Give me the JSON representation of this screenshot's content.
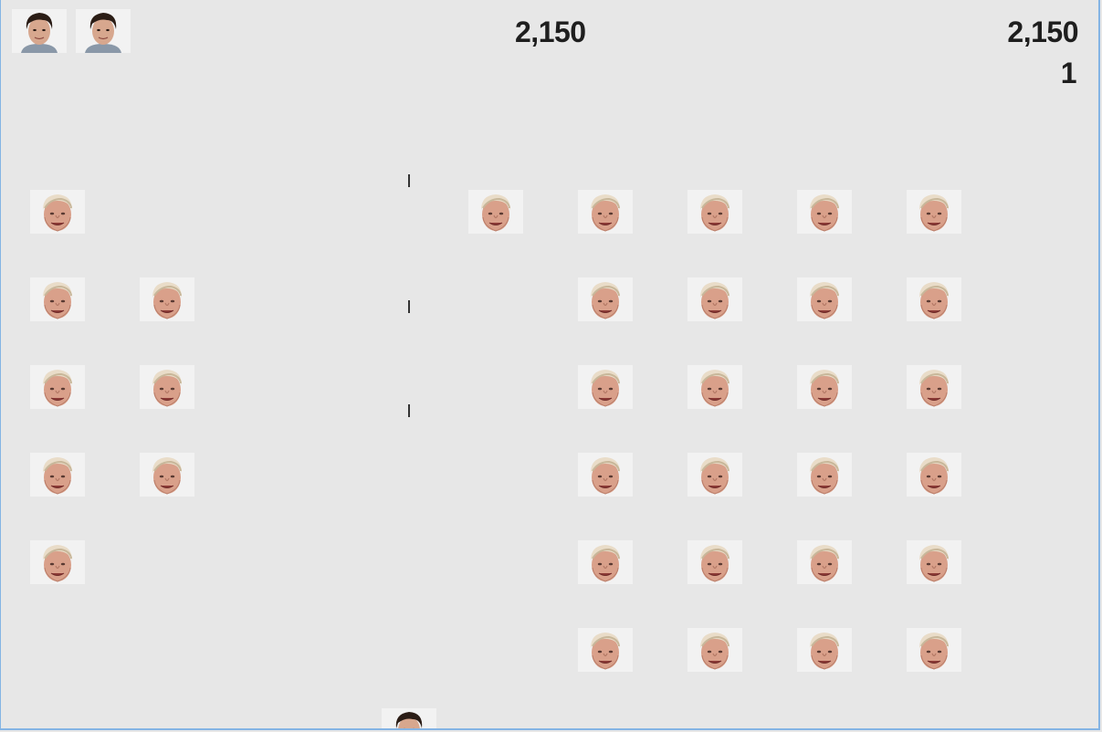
{
  "hud": {
    "score": "2,150",
    "high_score": "2,150",
    "level": "1",
    "lives": 2
  },
  "player": {
    "icon": "player-face-icon"
  },
  "enemy_icon": "enemy-face-icon",
  "colors": {
    "background": "#e7e7e7",
    "border": "#84b4e4",
    "text": "#1e1e1e"
  },
  "enemy_grid": {
    "columns": 9,
    "rows": 6,
    "alive": [
      [
        1,
        0,
        0,
        0,
        1,
        1,
        1,
        1,
        1
      ],
      [
        1,
        1,
        0,
        0,
        0,
        1,
        1,
        1,
        1
      ],
      [
        1,
        1,
        0,
        0,
        0,
        1,
        1,
        1,
        1
      ],
      [
        1,
        1,
        0,
        0,
        0,
        1,
        1,
        1,
        1
      ],
      [
        1,
        0,
        0,
        0,
        0,
        1,
        1,
        1,
        1
      ],
      [
        0,
        0,
        0,
        0,
        0,
        1,
        1,
        1,
        1
      ]
    ]
  },
  "bullets_in_flight": 3
}
